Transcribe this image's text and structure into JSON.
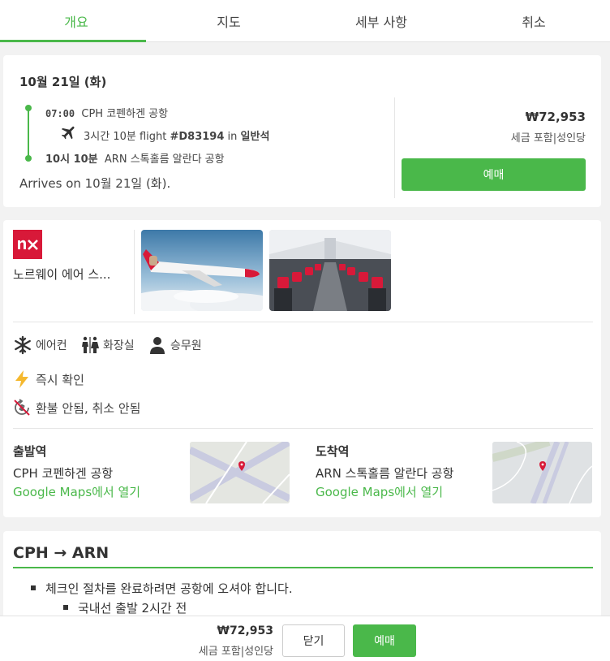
{
  "tabs": [
    "개요",
    "지도",
    "세부 사항",
    "취소"
  ],
  "flight": {
    "date": "10월 21일 (화)",
    "dep_time": "07:00",
    "dep_airport": "CPH 코펜하겐 공항",
    "duration": "3시간 10분 flight ",
    "flight_no": "#D83194",
    "in_word": " in ",
    "cabin": "일반석",
    "arr_time": "10시 10분",
    "arr_airport": "ARN 스톡홀름 알란다 공항",
    "arrives": "Arrives on 10월 21일 (화).",
    "price": "₩72,953",
    "price_note": "세금 포함|성인당",
    "book": "예매"
  },
  "airline": {
    "logo_text": "n⨯",
    "name": "노르웨이 에어 스...",
    "amenities": [
      "에어컨",
      "화장실",
      "승무원"
    ],
    "features": [
      "즉시 확인",
      "환불 안됨, 취소 안됨"
    ],
    "departure": {
      "title": "출발역",
      "name": "CPH 코펜하겐 공항",
      "link": "Google Maps에서 열기"
    },
    "arrival": {
      "title": "도착역",
      "name": "ARN 스톡홀름 알란다 공항",
      "link": "Google Maps에서 열기"
    }
  },
  "route": {
    "title": "CPH → ARN",
    "items": [
      "체크인 절차를 완료하려면 공항에 오셔야 합니다.",
      "국내선 출발 2시간 전"
    ]
  },
  "bottom": {
    "price": "₩72,953",
    "note": "세금 포함|성인당",
    "close": "닫기",
    "book": "예매"
  },
  "colors": {
    "accent": "#4ab84a",
    "brand": "#d81939"
  }
}
